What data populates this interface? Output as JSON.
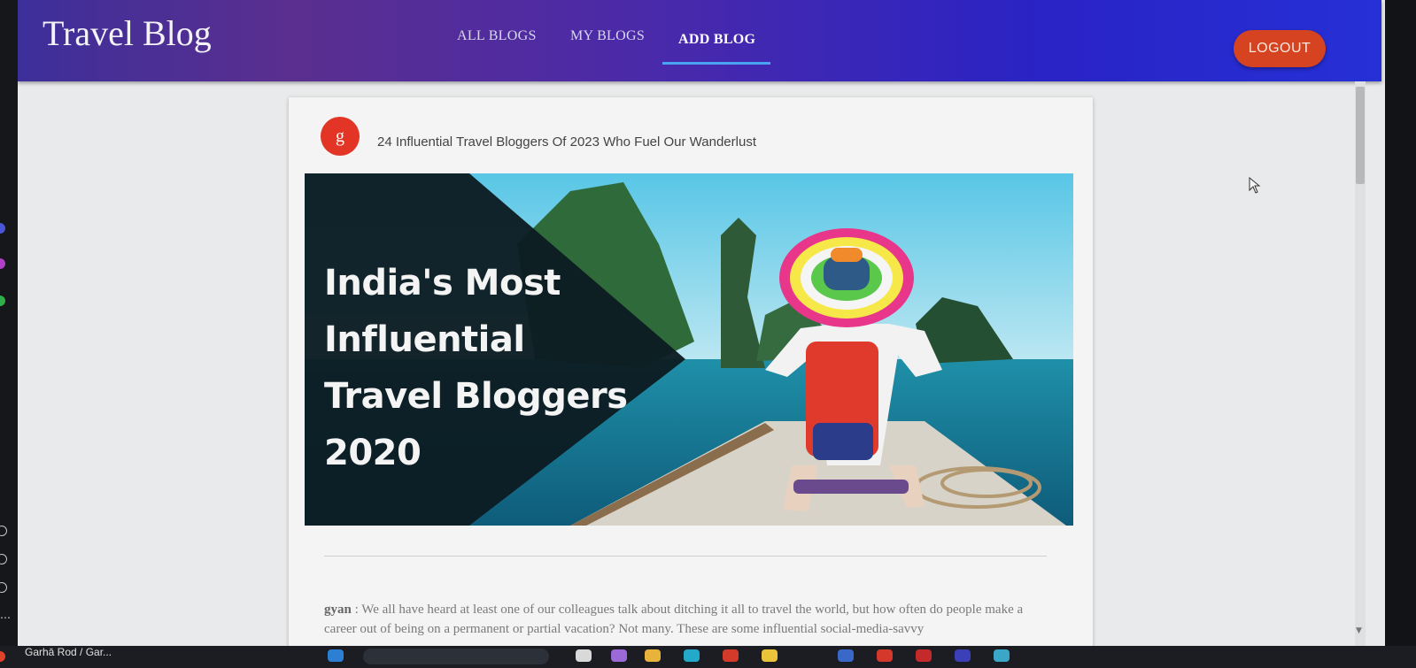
{
  "app": {
    "brand": "Travel Blog",
    "nav": [
      {
        "label": "ALL BLOGS",
        "active": false
      },
      {
        "label": "MY BLOGS",
        "active": false
      },
      {
        "label": "ADD BLOG",
        "active": true
      }
    ],
    "logout_label": "LOGOUT"
  },
  "post": {
    "avatar_letter": "g",
    "title": "24 Influential Travel Bloggers Of 2023 Who Fuel Our Wanderlust",
    "image_headline": [
      "India's Most",
      "Influential",
      "Travel Bloggers",
      "2020"
    ],
    "author": "gyan",
    "separator": " : ",
    "body": "We all have heard at least one of our colleagues talk about ditching it all to travel the world, but how often do people make a career out of being on a permanent or partial vacation? Not many. These are some influential social-media-savvy"
  },
  "taskbar": {
    "window_label": "Garhā Rod / Gar..."
  },
  "colors": {
    "appbar_start": "#3d2f9a",
    "appbar_end": "#2530d6",
    "logout": "#d64321",
    "avatar": "#e23525",
    "tab_indicator": "#4aa3f0"
  },
  "icons": {
    "cursor": "pointer-cursor-icon",
    "scroll_down": "chevron-down-icon"
  }
}
